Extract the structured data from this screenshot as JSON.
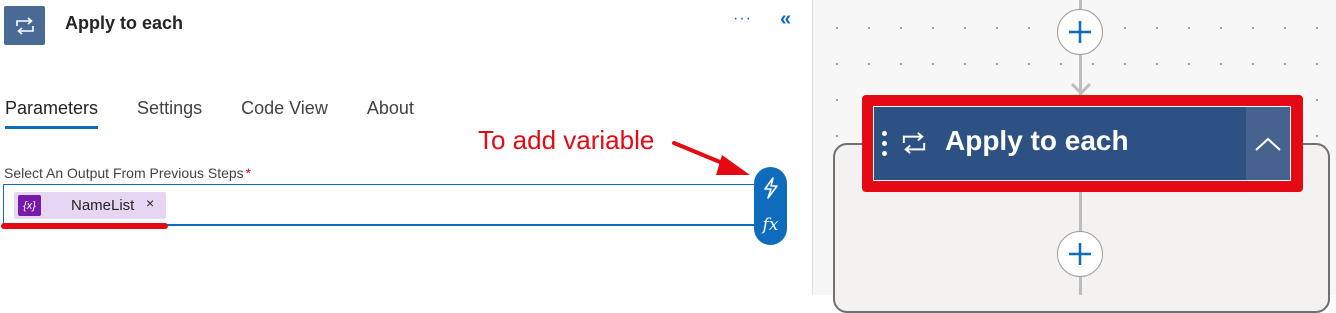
{
  "header": {
    "title": "Apply to each",
    "more_label": "···",
    "collapse_label": "«"
  },
  "tabs": [
    {
      "label": "Parameters",
      "active": true
    },
    {
      "label": "Settings",
      "active": false
    },
    {
      "label": "Code View",
      "active": false
    },
    {
      "label": "About",
      "active": false
    }
  ],
  "field": {
    "label": "Select An Output From Previous Steps",
    "required_marker": "*",
    "token": {
      "icon_text": "{x}",
      "label": "NameList",
      "remove_label": "×"
    }
  },
  "insert_buttons": {
    "dynamic_content_icon": "lightning-icon",
    "expression_label": "fx"
  },
  "annotation": {
    "text": "To add variable"
  },
  "canvas": {
    "node_title": "Apply to each"
  },
  "colors": {
    "accent": "#0f6cbd",
    "node": "#2d5182",
    "annotation_red": "#e50914",
    "variable_token": "#7719aa"
  }
}
